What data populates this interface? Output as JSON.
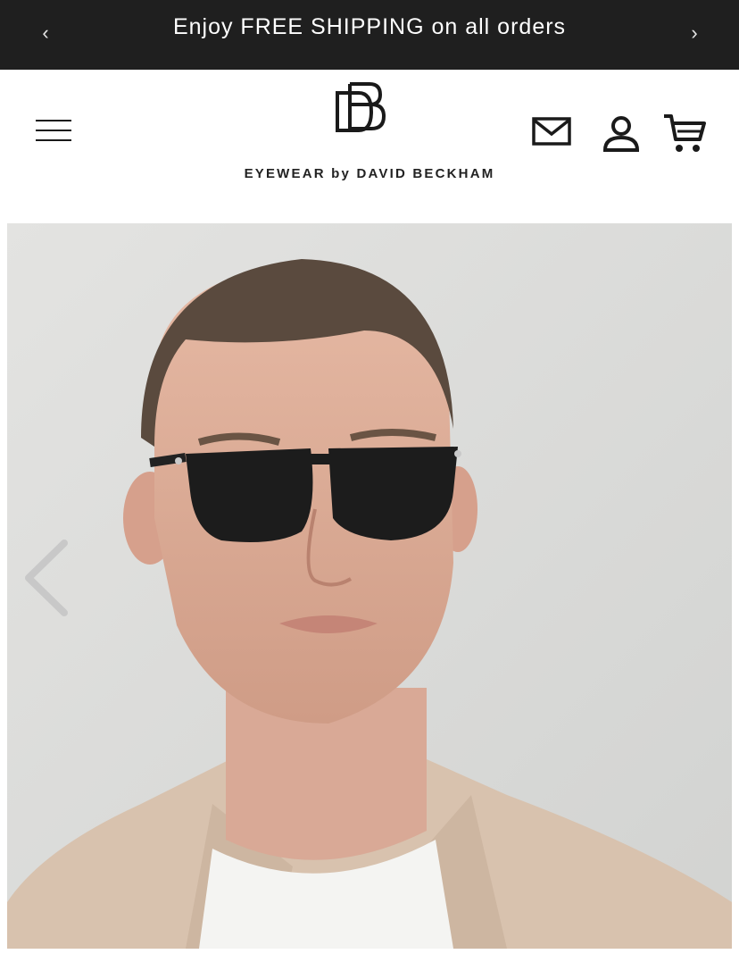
{
  "announcement": {
    "text": "Enjoy FREE SHIPPING on all orders",
    "prev_icon": "chevron-left-icon",
    "next_icon": "chevron-right-icon",
    "background": "#1f1f1f"
  },
  "header": {
    "menu_icon": "hamburger-icon",
    "logo_alt": "DB monogram logo",
    "brand": "EYEWEAR by DAVID BECKHAM",
    "icons": [
      "mail-icon",
      "account-icon",
      "cart-icon"
    ]
  },
  "hero": {
    "image": "model-wearing-black-sunglasses",
    "prev_icon": "chevron-left-icon"
  }
}
